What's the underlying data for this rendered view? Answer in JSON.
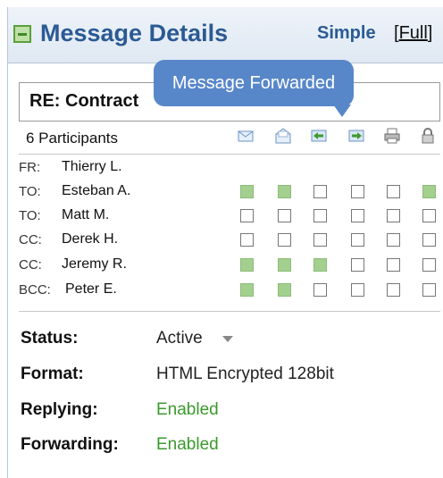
{
  "header": {
    "title": "Message Details",
    "view_simple": "Simple",
    "view_full_open": "[",
    "view_full": "Full",
    "view_full_close": "]"
  },
  "subject": "RE: Contract",
  "tooltip": "Message Forwarded",
  "participants_label": "6 Participants",
  "action_icons": [
    "mail-read-icon",
    "mail-opened-icon",
    "reply-icon",
    "forward-icon",
    "print-icon",
    "lock-icon"
  ],
  "participants": [
    {
      "role": "FR:",
      "name": "Thierry L.",
      "flags": []
    },
    {
      "role": "TO:",
      "name": "Esteban A.",
      "flags": [
        true,
        true,
        false,
        false,
        false,
        true
      ]
    },
    {
      "role": "TO:",
      "name": "Matt M.",
      "flags": [
        false,
        false,
        false,
        false,
        false,
        false
      ]
    },
    {
      "role": "CC:",
      "name": "Derek H.",
      "flags": [
        false,
        false,
        false,
        false,
        false,
        false
      ]
    },
    {
      "role": "CC:",
      "name": "Jeremy R.",
      "flags": [
        true,
        true,
        true,
        false,
        false,
        false
      ]
    },
    {
      "role": "BCC:",
      "name": "Peter E.",
      "flags": [
        true,
        true,
        false,
        false,
        false,
        false
      ]
    }
  ],
  "fields": {
    "status_label": "Status:",
    "status_value": "Active",
    "format_label": "Format:",
    "format_value": "HTML Encrypted 128bit",
    "replying_label": "Replying:",
    "replying_value": "Enabled",
    "forwarding_label": "Forwarding:",
    "forwarding_value": "Enabled"
  },
  "colors": {
    "enabled": "#3a9a2c",
    "title": "#2b5a94",
    "tooltip": "#5887c9",
    "checked": "#a3d08e"
  }
}
